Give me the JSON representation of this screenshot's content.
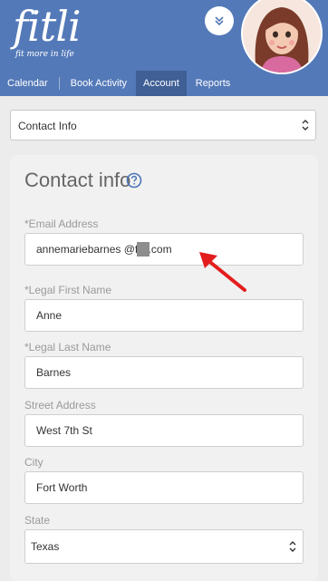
{
  "app": {
    "logo_text": "fitli",
    "tagline": "fit more in life"
  },
  "nav": {
    "items": [
      {
        "label": "Calendar",
        "active": false
      },
      {
        "label": "Book Activity",
        "active": false
      },
      {
        "label": "Account",
        "active": true
      },
      {
        "label": "Reports",
        "active": false
      }
    ]
  },
  "section_select": {
    "selected": "Contact Info"
  },
  "contact": {
    "title": "Contact info",
    "fields": [
      {
        "label": "*Email Address",
        "value": "annemariebarnes       @fitli.com"
      },
      {
        "label": "*Legal First Name",
        "value": "Anne"
      },
      {
        "label": "*Legal Last Name",
        "value": "Barnes"
      },
      {
        "label": "Street Address",
        "value": "West 7th St"
      },
      {
        "label": "City",
        "value": "Fort Worth"
      }
    ],
    "state": {
      "label": "State",
      "value": "Texas"
    }
  },
  "icons": {
    "collapse": "chevron-double-down-icon",
    "help": "question-circle-icon",
    "select": "chevron-up-down-icon"
  },
  "colors": {
    "header_bg": "#5479b8",
    "nav_active_bg": "#3f5f95",
    "help_icon": "#4a74b8",
    "annotation_arrow": "#e31d1d"
  }
}
